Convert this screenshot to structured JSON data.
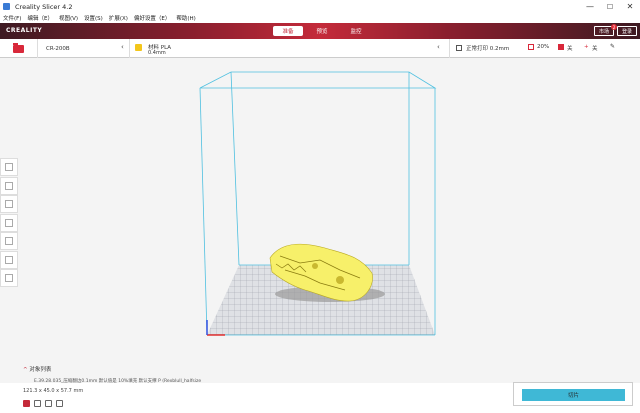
{
  "window": {
    "title": "Creality Slicer 4.2",
    "controls": [
      "—",
      "☐",
      "✕"
    ]
  },
  "menu": [
    "文件(F)",
    "编辑（E）",
    "视图(V)",
    "设置(S)",
    "扩展(X)",
    "偏好设置（E）",
    "帮助(H)"
  ],
  "brand": "CREALITY",
  "mode_tabs": [
    {
      "label": "准备",
      "active": true
    },
    {
      "label": "预览",
      "active": false
    },
    {
      "label": "监控",
      "active": false
    }
  ],
  "top_right": {
    "login_label": "市场",
    "register_label": "登录",
    "notification_count": "2"
  },
  "toolbar": {
    "printer": "CR-200B",
    "material_label": "材料 PLA",
    "material_sub": "0.4mm",
    "profile": "正常打印 0.2mm",
    "infill": "20%",
    "support": "关",
    "adhesion": "关"
  },
  "object_list": {
    "title": "对象列表",
    "file_row": "E.39.28.035_压缩翻边0.1mm 默认值是 10%填充 默认支撑 P (Rexblull_halfsize",
    "dimensions": "121.3 x 45.0 x 57.7 mm"
  },
  "slice_button": "切片",
  "colors": {
    "accent_red": "#c42a3a",
    "cyan": "#3fb8d6",
    "model_yellow": "#f7f06a"
  }
}
